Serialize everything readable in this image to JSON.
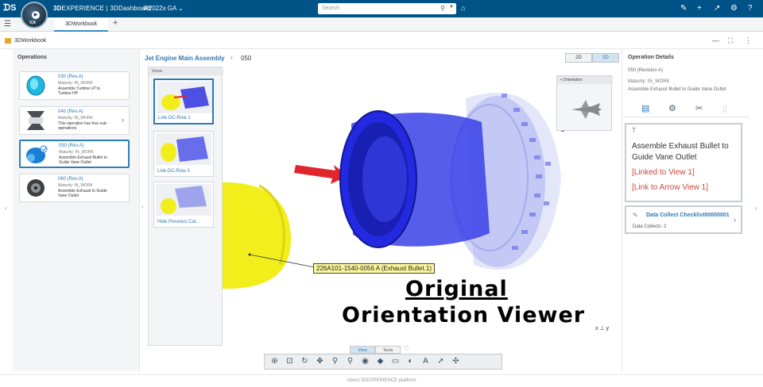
{
  "topbar": {
    "brand_bold": "3D",
    "brand_rest": "EXPERIENCE | 3DDashboard",
    "version": "R2022x GA",
    "search_placeholder": "Search",
    "compass_label": "V,R"
  },
  "tabs": {
    "active": "3DWorkbook"
  },
  "app": {
    "title": "3DWorkbook"
  },
  "operations": {
    "heading": "Operations",
    "items": [
      {
        "rev": "030   (Rev.A)",
        "maturity": "Maturity: IN_WORK",
        "desc": "Assemble Turbine LP to Turbine HP"
      },
      {
        "rev": "040   (Rev.A)",
        "maturity": "Maturity: IN_WORK",
        "desc": "This operation has four sub-operations"
      },
      {
        "rev": "050   (Rev.A)",
        "maturity": "Maturity: IN_WORK",
        "desc": "Assemble Exhaust Bullet to Guide Vane Outlet"
      },
      {
        "rev": "060   (Rev.A)",
        "maturity": "Maturity: IN_WORK",
        "desc": "Assemble Exhaust to Guide Vane Outlet"
      }
    ]
  },
  "viewer": {
    "breadcrumb_root": "Jet Engine Main Assembly",
    "breadcrumb_sep": "›",
    "breadcrumb_current": "050",
    "toggle_2d": "2D",
    "toggle_3d": "3D",
    "views_heading": "Views",
    "views": [
      {
        "label": "Link-DC-Row 1"
      },
      {
        "label": "Link-DC-Row 2"
      },
      {
        "label": "Hide Previous Cat..."
      }
    ],
    "orientation_heading": "Orientation",
    "part_label": "226A101-1540-0056 A (Exhaust Bullet.1)",
    "overlay_line1": "Original",
    "overlay_line2": "Orientation Viewer",
    "axes": "x ⊥ y",
    "toolbar_tab_view": "View",
    "toolbar_tab_tools": "Tools"
  },
  "details": {
    "heading": "Operation Details",
    "revision": "050 (Revision A)",
    "maturity": "Maturity: IN_WORK",
    "desc": "Assemble Exhaust Bullet to Guide Vane Outlet",
    "note_type": "T",
    "note_text": "Assemble Exhaust Bullet to Guide Vane Outlet",
    "link1": "[Linked to View 1]",
    "link2": "[Link to Arrow View 1]",
    "dc_title": "Data Collect Checklist00000001",
    "dc_count": "Data Collects: 2"
  },
  "footer": {
    "text": "About 3DEXPERIENCE platform"
  },
  "colors": {
    "topbar": "#005386",
    "accent": "#2f77b5",
    "engine_blue": "#2329e0",
    "bullet_yellow": "#f2ee1c",
    "arrow_red": "#e0262d"
  }
}
